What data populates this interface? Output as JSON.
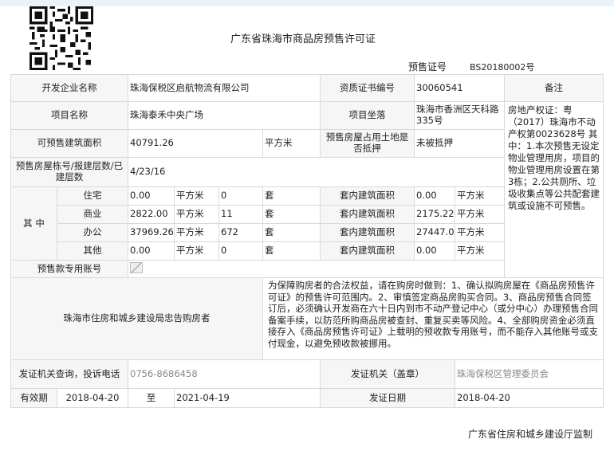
{
  "header": {
    "title": "广东省珠海市商品房预售许可证",
    "permit_label": "预售证号",
    "permit_no": "BS20180002号"
  },
  "rows": {
    "developer_label": "开发企业名称",
    "developer_value": "珠海保税区启航物流有限公司",
    "cert_label": "资质证书编号",
    "cert_value": "30060541",
    "remark_label": "备注",
    "project_label": "项目名称",
    "project_value": "珠海泰禾中央广场",
    "location_label": "项目坐落",
    "location_value": "珠海市香洲区天科路335号",
    "area_label": "可预售建筑面积",
    "area_value": "40791.26",
    "area_unit": "平方米",
    "mortgage_label": "预售房屋占用土地是否抵押",
    "mortgage_value": "未被抵押",
    "building_label": "预售房屋栋号/报建层数/已建层数",
    "building_value": "4/23/16",
    "among_label": "其 中",
    "account_label": "预售款专用账号"
  },
  "breakdown": [
    {
      "type": "住宅",
      "area": "0.00",
      "area_unit": "平方米",
      "count": "0",
      "count_unit": "套",
      "inner_label": "套内建筑面积",
      "inner_value": "0.00",
      "inner_unit": "平方米"
    },
    {
      "type": "商业",
      "area": "2822.00",
      "area_unit": "平方米",
      "count": "11",
      "count_unit": "套",
      "inner_label": "套内建筑面积",
      "inner_value": "2175.22",
      "inner_unit": "平方米"
    },
    {
      "type": "办公",
      "area": "37969.26",
      "area_unit": "平方米",
      "count": "672",
      "count_unit": "套",
      "inner_label": "套内建筑面积",
      "inner_value": "27447.0(",
      "inner_unit": "平方米"
    },
    {
      "type": "其他",
      "area": "0.00",
      "area_unit": "平方米",
      "count": "0",
      "count_unit": "套",
      "inner_label": "套内建筑面积",
      "inner_value": "0.00",
      "inner_unit": "平方米"
    }
  ],
  "remark_text": "房地产权证：粤（2017）珠海市不动产权第0023628号 其中：1.本次预售无设定物业管理用房，项目的物业管理用房设置在第3栋；2.公共厕所、垃圾收集点等公共配套建筑或设施不可预售。",
  "notice": {
    "label": "珠海市住房和城乡建设局忠告购房者",
    "text": "为保障购房者的合法权益，请在购房时做到：1、确认拟购房屋在《商品房预售许可证》的预售许可范围内。2、审慎签定商品房购买合同。3、商品房预售合同签订后，必须确认开发商在六十日内到市不动产登记中心（或分中心）办理预售合同备案手续，以防范所购商品房被查封、重复买卖等风险。4、全部购房资金必须直接存入《商品房预售许可证》上载明的预收款专用账号，而不能存入其他账号或支付现金，以避免预收款被挪用。"
  },
  "contact": {
    "label": "发证机关查询，投诉电话",
    "phone": "0756-8686458",
    "issuer_label": "发证机关（盖章）",
    "issuer_value": "珠海保税区管理委员会"
  },
  "validity": {
    "label": "有效期",
    "start": "2018-04-20",
    "to": "至",
    "end": "2021-04-19",
    "issue_label": "发证日期",
    "issue_date": "2018-04-20"
  },
  "footer": "广东省住房和城乡建设厅监制"
}
